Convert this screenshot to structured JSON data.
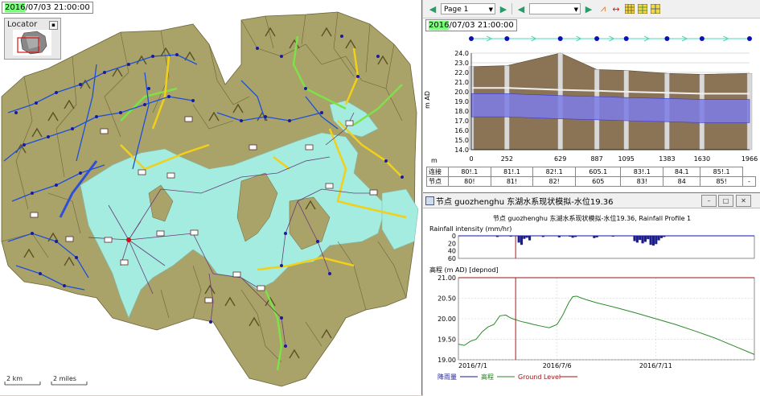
{
  "map": {
    "timestamp_year": "2016",
    "timestamp_rest": "/07/03 21:00:00",
    "locator_title": "Locator",
    "scale_km": "2 km",
    "scale_miles": "2 miles"
  },
  "toolbar": {
    "page_select": "Page 1",
    "secondary_select": ""
  },
  "profile": {
    "timestamp_year": "2016",
    "timestamp_rest": "/07/03 21:00:00",
    "ylabel": "m AD",
    "xlabel": "m",
    "row_labels": [
      "连接",
      "节点"
    ],
    "link_cells": [
      "80!.1",
      "81!.1",
      "82!.1",
      "605.1",
      "83!.1",
      "84.1",
      "85!.1"
    ],
    "node_cells": [
      "80!",
      "81!",
      "82!",
      "605",
      "83!",
      "84",
      "85!",
      "-"
    ]
  },
  "graph": {
    "window_title": "节点 guozhenghu 东湖水系现状模拟-水位19.36",
    "plot_title": "节点 guozhenghu 东湖水系现状模拟-水位19.36, Rainfall Profile 1",
    "rain_label": "Rainfall intensity (mm/hr)",
    "level_label": "高程 (m AD) [depnod]",
    "legend": {
      "rain": "降雨量",
      "level": "高程",
      "ground": "Ground Level"
    }
  },
  "chart_data": [
    {
      "type": "area",
      "title": "",
      "xlabel": "m",
      "ylabel": "m AD",
      "x_ticks": [
        0,
        252,
        629,
        887,
        1095,
        1383,
        1630,
        1966
      ],
      "y_ticks": [
        14.0,
        15.0,
        16.0,
        17.0,
        18.0,
        19.0,
        20.0,
        21.0,
        22.0,
        23.0,
        24.0
      ],
      "ylim": [
        14.0,
        24.0
      ],
      "xlim": [
        0,
        1966
      ],
      "series": [
        {
          "values": [
            22.6,
            22.7,
            24.0,
            22.3,
            22.2,
            21.9,
            21.8,
            21.9
          ]
        },
        {
          "values": [
            19.8,
            19.8,
            19.6,
            19.5,
            19.4,
            19.3,
            19.2,
            19.2
          ]
        }
      ],
      "grid": true,
      "colors": {
        "soil": "#8b7356",
        "water": "#7d7de8",
        "pipe": "#c9c9c9"
      }
    },
    {
      "type": "bar",
      "title": "",
      "ylabel": "Rainfall intensity (mm/hr)",
      "y_ticks": [
        0,
        20,
        40,
        60
      ],
      "ylim": [
        0,
        60
      ],
      "x_ticks": [
        "2016/7/1",
        "2016/7/6",
        "2016/7/11"
      ],
      "values": [
        0,
        0,
        0,
        0,
        0,
        0,
        0,
        0,
        0,
        0,
        0,
        0,
        0,
        0,
        3,
        0,
        0,
        1,
        0,
        2,
        0,
        0,
        18,
        24,
        8,
        5,
        12,
        0,
        0,
        0,
        0,
        3,
        0,
        0,
        0,
        0,
        0,
        4,
        0,
        0,
        0,
        2,
        5,
        3,
        0,
        0,
        0,
        0,
        0,
        0,
        6,
        4,
        0,
        0,
        0,
        1,
        0,
        2,
        0,
        0,
        0,
        0,
        0,
        0,
        0,
        14,
        18,
        11,
        20,
        16,
        9,
        24,
        26,
        22,
        12,
        6,
        3,
        0,
        0,
        0,
        0,
        0,
        0,
        0,
        0,
        0,
        0,
        0,
        0,
        0,
        0,
        0,
        0,
        0,
        0,
        0,
        0,
        0,
        0,
        0,
        0,
        0,
        0,
        0,
        0,
        0,
        0,
        0,
        0,
        0
      ],
      "colors": {
        "bar": "#1c1c8c"
      }
    },
    {
      "type": "line",
      "title": "",
      "ylabel": "高程 (m AD) [depnod]",
      "y_ticks": [
        19.0,
        19.5,
        20.0,
        20.5,
        21.0
      ],
      "ylim": [
        19.0,
        21.0
      ],
      "x_ticks": [
        "2016/7/1",
        "2016/7/6",
        "2016/7/11"
      ],
      "series": [
        {
          "name": "高程",
          "x": [
            0,
            0.3,
            0.6,
            0.9,
            1.2,
            1.5,
            1.8,
            2.1,
            2.4,
            2.6,
            2.8,
            3.0,
            3.2,
            3.5,
            3.8,
            4.2,
            4.6,
            5.0,
            5.3,
            5.6,
            5.8,
            6.0,
            6.2,
            6.5,
            7.0,
            8.0,
            9.0,
            10.0,
            11.0,
            12.0,
            13.0,
            14.0,
            15.0
          ],
          "y": [
            19.38,
            19.35,
            19.45,
            19.5,
            19.68,
            19.8,
            19.86,
            20.07,
            20.09,
            20.03,
            19.99,
            19.96,
            19.93,
            19.9,
            19.86,
            19.82,
            19.78,
            19.86,
            20.1,
            20.4,
            20.54,
            20.55,
            20.51,
            20.46,
            20.39,
            20.27,
            20.14,
            20.0,
            19.86,
            19.7,
            19.53,
            19.33,
            19.13
          ],
          "color": "#2a8a2a"
        },
        {
          "name": "Ground Level",
          "x": [
            0,
            15
          ],
          "y": [
            21.0,
            21.0
          ],
          "color": "#a01010"
        }
      ],
      "marker_day": 2.9,
      "xlim_days": [
        0,
        15
      ]
    }
  ]
}
